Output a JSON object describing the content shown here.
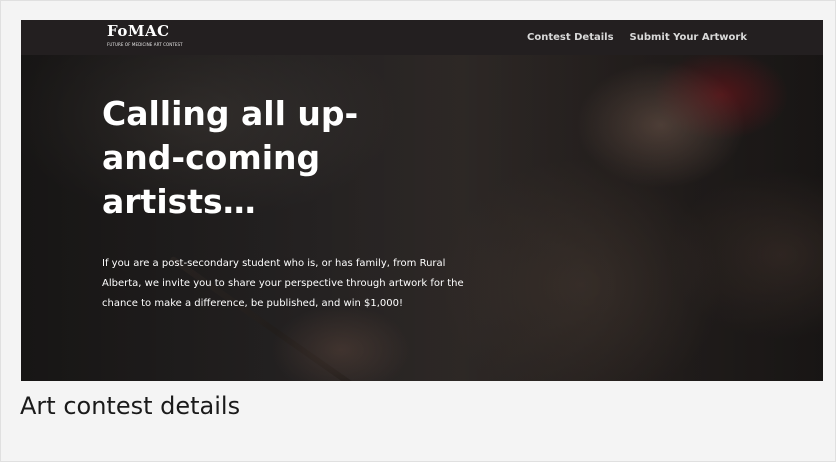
{
  "header": {
    "logo_text": "FoMAC",
    "logo_subtitle": "FUTURE OF MEDICINE ART CONTEST",
    "nav": [
      {
        "label": "Contest Details"
      },
      {
        "label": "Submit Your Artwork"
      }
    ]
  },
  "hero": {
    "title": "Calling all up-and-coming artists…",
    "text": "If you are a post-secondary student who is, or has family, from Rural Alberta, we invite you to share your perspective through artwork for the chance to make a difference, be published, and win $1,000!"
  },
  "page": {
    "heading": "Art contest details"
  },
  "colors": {
    "navbar_bg": "#231f20",
    "hero_text": "#ffffff",
    "page_bg": "#f4f4f4"
  }
}
